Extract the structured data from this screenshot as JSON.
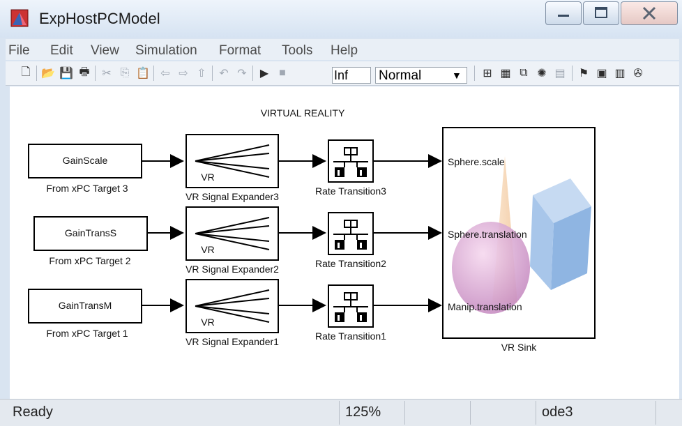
{
  "window": {
    "title": "ExpHostPCModel"
  },
  "menu": [
    "File",
    "Edit",
    "View",
    "Simulation",
    "Format",
    "Tools",
    "Help"
  ],
  "toolbar": {
    "stop_time": "Inf",
    "sim_mode": "Normal"
  },
  "diagram": {
    "title": "VIRTUAL REALITY",
    "sources": [
      {
        "name": "GainScale",
        "caption": "From xPC Target 3"
      },
      {
        "name": "GainTransS",
        "caption": "From xPC Target 2"
      },
      {
        "name": "GainTransM",
        "caption": "From xPC Target 1"
      }
    ],
    "expanders": [
      {
        "text": "VR",
        "caption": "VR Signal Expander3"
      },
      {
        "text": "VR",
        "caption": "VR Signal Expander2"
      },
      {
        "text": "VR",
        "caption": "VR Signal Expander1"
      }
    ],
    "rate_transitions": [
      {
        "caption": "Rate Transition3"
      },
      {
        "caption": "Rate Transition2"
      },
      {
        "caption": "Rate Transition1"
      }
    ],
    "sink": {
      "caption": "VR Sink",
      "ports": [
        "Sphere.scale",
        "Sphere.translation",
        "Manip.translation"
      ]
    }
  },
  "status": {
    "state": "Ready",
    "zoom": "125%",
    "solver": "ode3"
  }
}
